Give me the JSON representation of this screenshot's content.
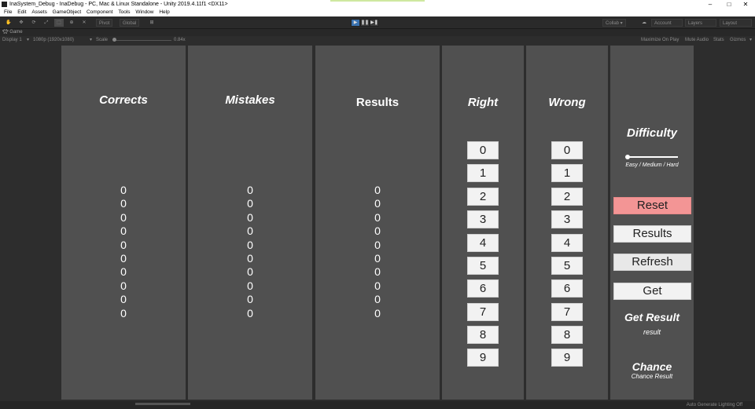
{
  "window": {
    "title": "InaSystem_Debug - InaDebug - PC, Mac & Linux Standalone - Unity 2019.4.11f1 <DX11>",
    "minimize": "–",
    "maximize": "□",
    "close": "✕"
  },
  "menu": [
    "File",
    "Edit",
    "Assets",
    "GameObject",
    "Component",
    "Tools",
    "Window",
    "Help"
  ],
  "toolbar": {
    "pivot": "Pivot",
    "global": "Global",
    "collab": "Collab ▾",
    "account": "Account",
    "layers": "Layers",
    "layout": "Layout"
  },
  "game_tab": {
    "label": "Game"
  },
  "game_bar": {
    "display": "Display 1",
    "resolution": "1080p (1920x1080)",
    "scale_label": "Scale",
    "scale_value": "0.84x",
    "maximize_on_play": "Maximize On Play",
    "mute_audio": "Mute Audio",
    "stats": "Stats",
    "gizmos": "Gizmos"
  },
  "columns": {
    "corrects": {
      "title": "Corrects",
      "values": [
        "0",
        "0",
        "0",
        "0",
        "0",
        "0",
        "0",
        "0",
        "0",
        "0"
      ]
    },
    "mistakes": {
      "title": "Mistakes",
      "values": [
        "0",
        "0",
        "0",
        "0",
        "0",
        "0",
        "0",
        "0",
        "0",
        "0"
      ]
    },
    "results": {
      "title": "Results",
      "values": [
        "0",
        "0",
        "0",
        "0",
        "0",
        "0",
        "0",
        "0",
        "0",
        "0"
      ]
    }
  },
  "right": {
    "title": "Right",
    "buttons": [
      "0",
      "1",
      "2",
      "3",
      "4",
      "5",
      "6",
      "7",
      "8",
      "9"
    ]
  },
  "wrong": {
    "title": "Wrong",
    "buttons": [
      "0",
      "1",
      "2",
      "3",
      "4",
      "5",
      "6",
      "7",
      "8",
      "9"
    ]
  },
  "controls": {
    "difficulty_title": "Difficulty",
    "difficulty_level": 0,
    "difficulty_caption": "Easy / Medium / Hard",
    "reset": "Reset",
    "results": "Results",
    "refresh": "Refresh",
    "get": "Get",
    "get_result_title": "Get Result",
    "get_result_value": "result",
    "chance_title": "Chance",
    "chance_value": "Chance Result"
  },
  "status": {
    "lighting": "Auto Generate Lighting Off"
  },
  "colors": {
    "reset_bg": "#f39595",
    "panel_bg": "#505050",
    "viewport_bg": "#2d2d2d"
  }
}
